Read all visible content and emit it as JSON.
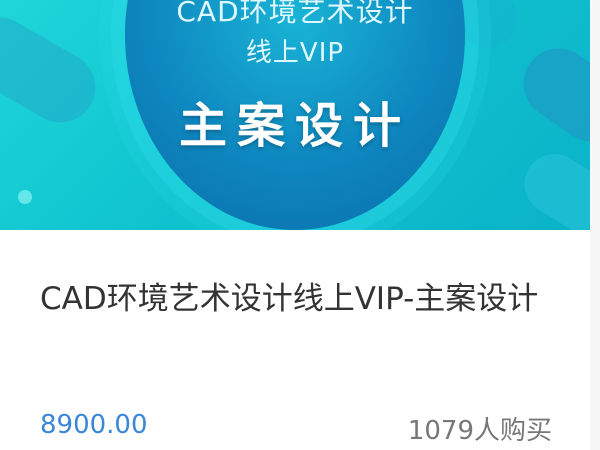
{
  "product": {
    "banner": {
      "line1": "CAD环境艺术设计",
      "line2": "线上VIP",
      "headline": "主案设计"
    },
    "title": "CAD环境艺术设计线上VIP-主案设计",
    "price": "8900.00",
    "buyers": "1079人购买"
  },
  "colors": {
    "accent_price": "#3a86d8",
    "banner_bg": "#10c3cf"
  }
}
